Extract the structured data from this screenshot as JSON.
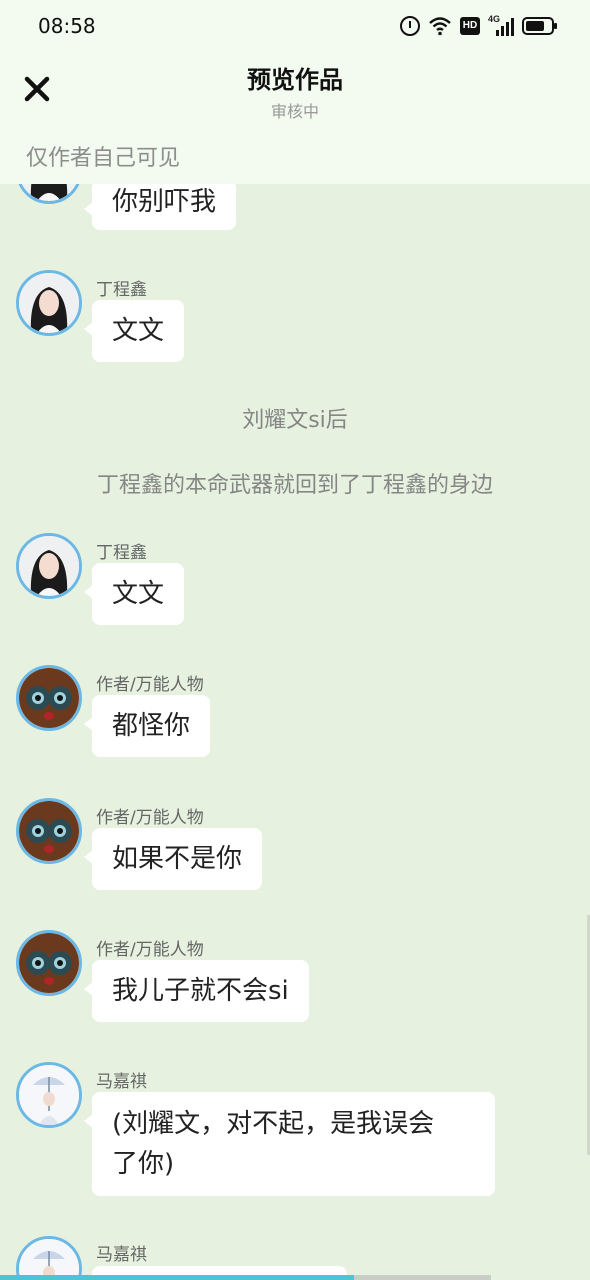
{
  "status_bar": {
    "time": "08:58",
    "network_label": "4G",
    "hd_label": "HD"
  },
  "header": {
    "title": "预览作品",
    "subtitle": "审核中",
    "visibility_note": "仅作者自己可见"
  },
  "messages": [
    {
      "type": "chat",
      "avatar": "girl-avatar",
      "name": "",
      "text": "你别吓我"
    },
    {
      "type": "chat",
      "avatar": "girl-avatar",
      "name": "丁程鑫",
      "text": "文文"
    },
    {
      "type": "narration",
      "text": "刘耀文si后"
    },
    {
      "type": "narration",
      "text": "丁程鑫的本命武器就回到了丁程鑫的身边"
    },
    {
      "type": "chat",
      "avatar": "girl-avatar",
      "name": "丁程鑫",
      "text": "文文"
    },
    {
      "type": "chat",
      "avatar": "owl-avatar",
      "name": "作者/万能人物",
      "text": "都怪你"
    },
    {
      "type": "chat",
      "avatar": "owl-avatar",
      "name": "作者/万能人物",
      "text": "如果不是你"
    },
    {
      "type": "chat",
      "avatar": "owl-avatar",
      "name": "作者/万能人物",
      "text": "我儿子就不会si"
    },
    {
      "type": "chat",
      "avatar": "umbrella-avatar",
      "name": "马嘉祺",
      "text_lines": [
        "(刘耀文，对不起，是我误会",
        "了你)"
      ]
    },
    {
      "type": "chat",
      "avatar": "umbrella-avatar",
      "name": "马嘉祺",
      "text": ""
    }
  ],
  "reading_progress": 0.6,
  "colors": {
    "background": "#e6f2df",
    "header_bg": "#f3faef",
    "avatar_ring": "#6bb8e6",
    "progress": "#4cc3d9"
  }
}
